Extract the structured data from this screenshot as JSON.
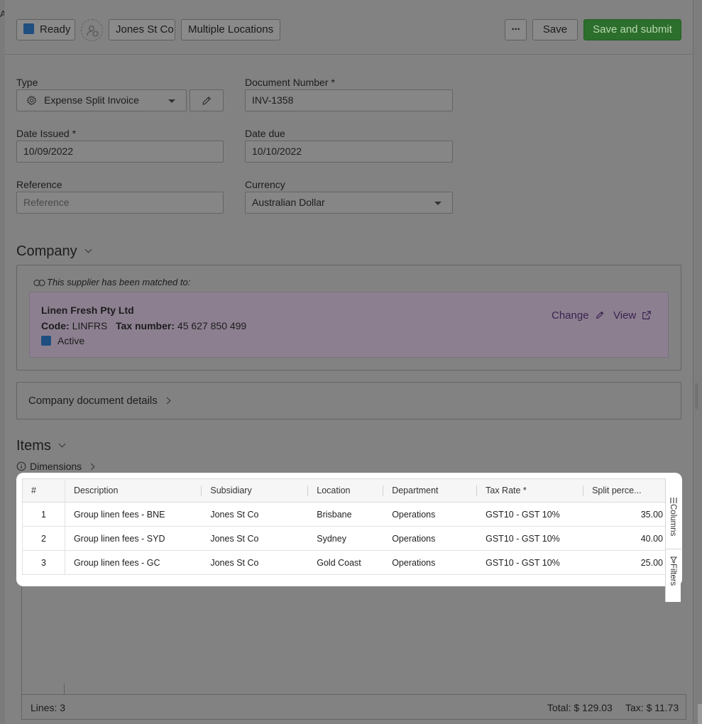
{
  "edge_text": "A",
  "header": {
    "status_label": "Ready",
    "status_color": "#1f4f80",
    "subsidiary_chip": "Jones St Co",
    "locations_chip": "Multiple Locations",
    "more_label": "···",
    "save_label": "Save",
    "submit_label": "Save and submit"
  },
  "form": {
    "type_label": "Type",
    "type_value": "Expense Split Invoice",
    "doc_number_label": "Document Number *",
    "doc_number_value": "INV-1358",
    "date_issued_label": "Date Issued *",
    "date_issued_value": "10/09/2022",
    "date_due_label": "Date due",
    "date_due_value": "10/10/2022",
    "reference_label": "Reference",
    "reference_placeholder": "Reference",
    "currency_label": "Currency",
    "currency_value": "Australian Dollar"
  },
  "company": {
    "title": "Company",
    "match_note": "This supplier has been matched to:",
    "supplier_name": "Linen Fresh Pty Ltd",
    "code_label": "Code:",
    "code_value": "LINFRS",
    "tax_label": "Tax number:",
    "tax_value": "45 627 850 499",
    "status": "Active",
    "change_label": "Change",
    "view_label": "View",
    "details_title": "Company document details"
  },
  "items": {
    "title": "Items",
    "dimensions_label": "Dimensions",
    "columns": [
      "#",
      "Description",
      "Subsidiary",
      "Location",
      "Department",
      "Tax Rate *",
      "Split perce..."
    ],
    "rows": [
      {
        "num": "1",
        "description": "Group linen fees - BNE",
        "subsidiary": "Jones St Co",
        "location": "Brisbane",
        "department": "Operations",
        "tax_rate": "GST10 - GST 10%",
        "split": "35.00"
      },
      {
        "num": "2",
        "description": "Group linen fees - SYD",
        "subsidiary": "Jones St Co",
        "location": "Sydney",
        "department": "Operations",
        "tax_rate": "GST10 - GST 10%",
        "split": "40.00"
      },
      {
        "num": "3",
        "description": "Group linen fees - GC",
        "subsidiary": "Jones St Co",
        "location": "Gold Coast",
        "department": "Operations",
        "tax_rate": "GST10 - GST 10%",
        "split": "25.00"
      }
    ],
    "columns_tab": "Columns",
    "filters_tab": "Filters",
    "lines_text": "Lines: 3",
    "total_text": "Total: $ 129.03",
    "tax_text": "Tax: $ 11.73"
  }
}
